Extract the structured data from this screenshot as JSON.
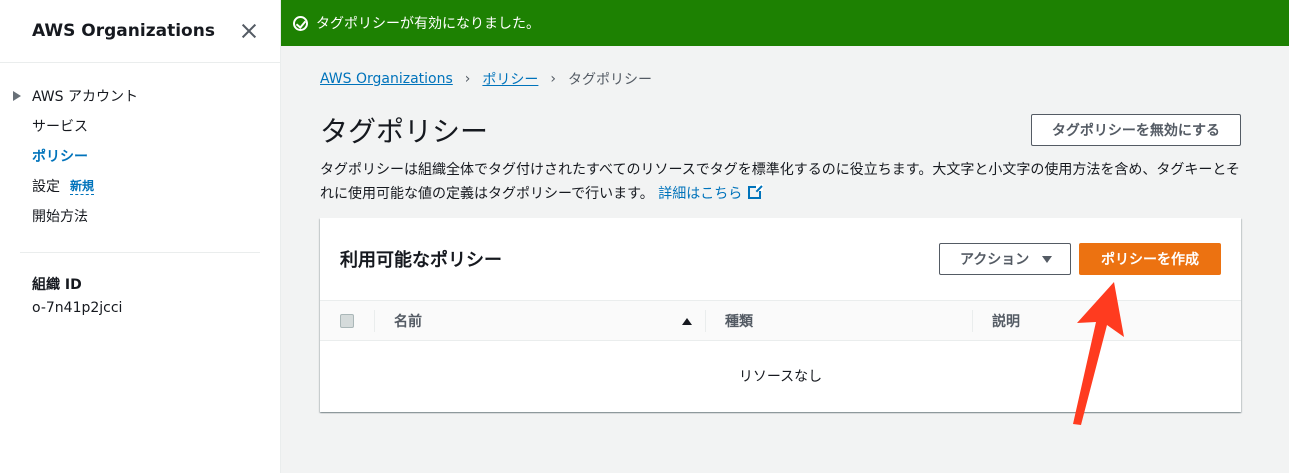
{
  "sidebar": {
    "title": "AWS Organizations",
    "items": [
      {
        "label": "AWS アカウント"
      },
      {
        "label": "サービス"
      },
      {
        "label": "ポリシー"
      },
      {
        "label": "設定",
        "badge": "新規"
      },
      {
        "label": "開始方法"
      }
    ],
    "org_id_label": "組織 ID",
    "org_id_value": "o-7n41p2jcci"
  },
  "flash": {
    "message": "タグポリシーが有効になりました。"
  },
  "breadcrumb": {
    "items": [
      "AWS Organizations",
      "ポリシー"
    ],
    "current": "タグポリシー"
  },
  "page": {
    "title": "タグポリシー",
    "disable_button": "タグポリシーを無効にする",
    "description_1": "タグポリシーは組織全体でタグ付けされたすべてのリソースでタグを標準化するのに役立ちます。大文字と小文字の使用方法を含め、タグキーとそ",
    "description_2": "れに使用可能な値の定義はタグポリシーで行います。",
    "details_link": "詳細はこちら"
  },
  "policies": {
    "title": "利用可能なポリシー",
    "actions_button": "アクション",
    "create_button": "ポリシーを作成",
    "columns": [
      "名前",
      "種類",
      "説明"
    ],
    "empty_text": "リソースなし"
  },
  "colors": {
    "success": "#1d8102",
    "link": "#0073bb",
    "primary": "#ec7211",
    "annotation": "#ff3b1f"
  }
}
